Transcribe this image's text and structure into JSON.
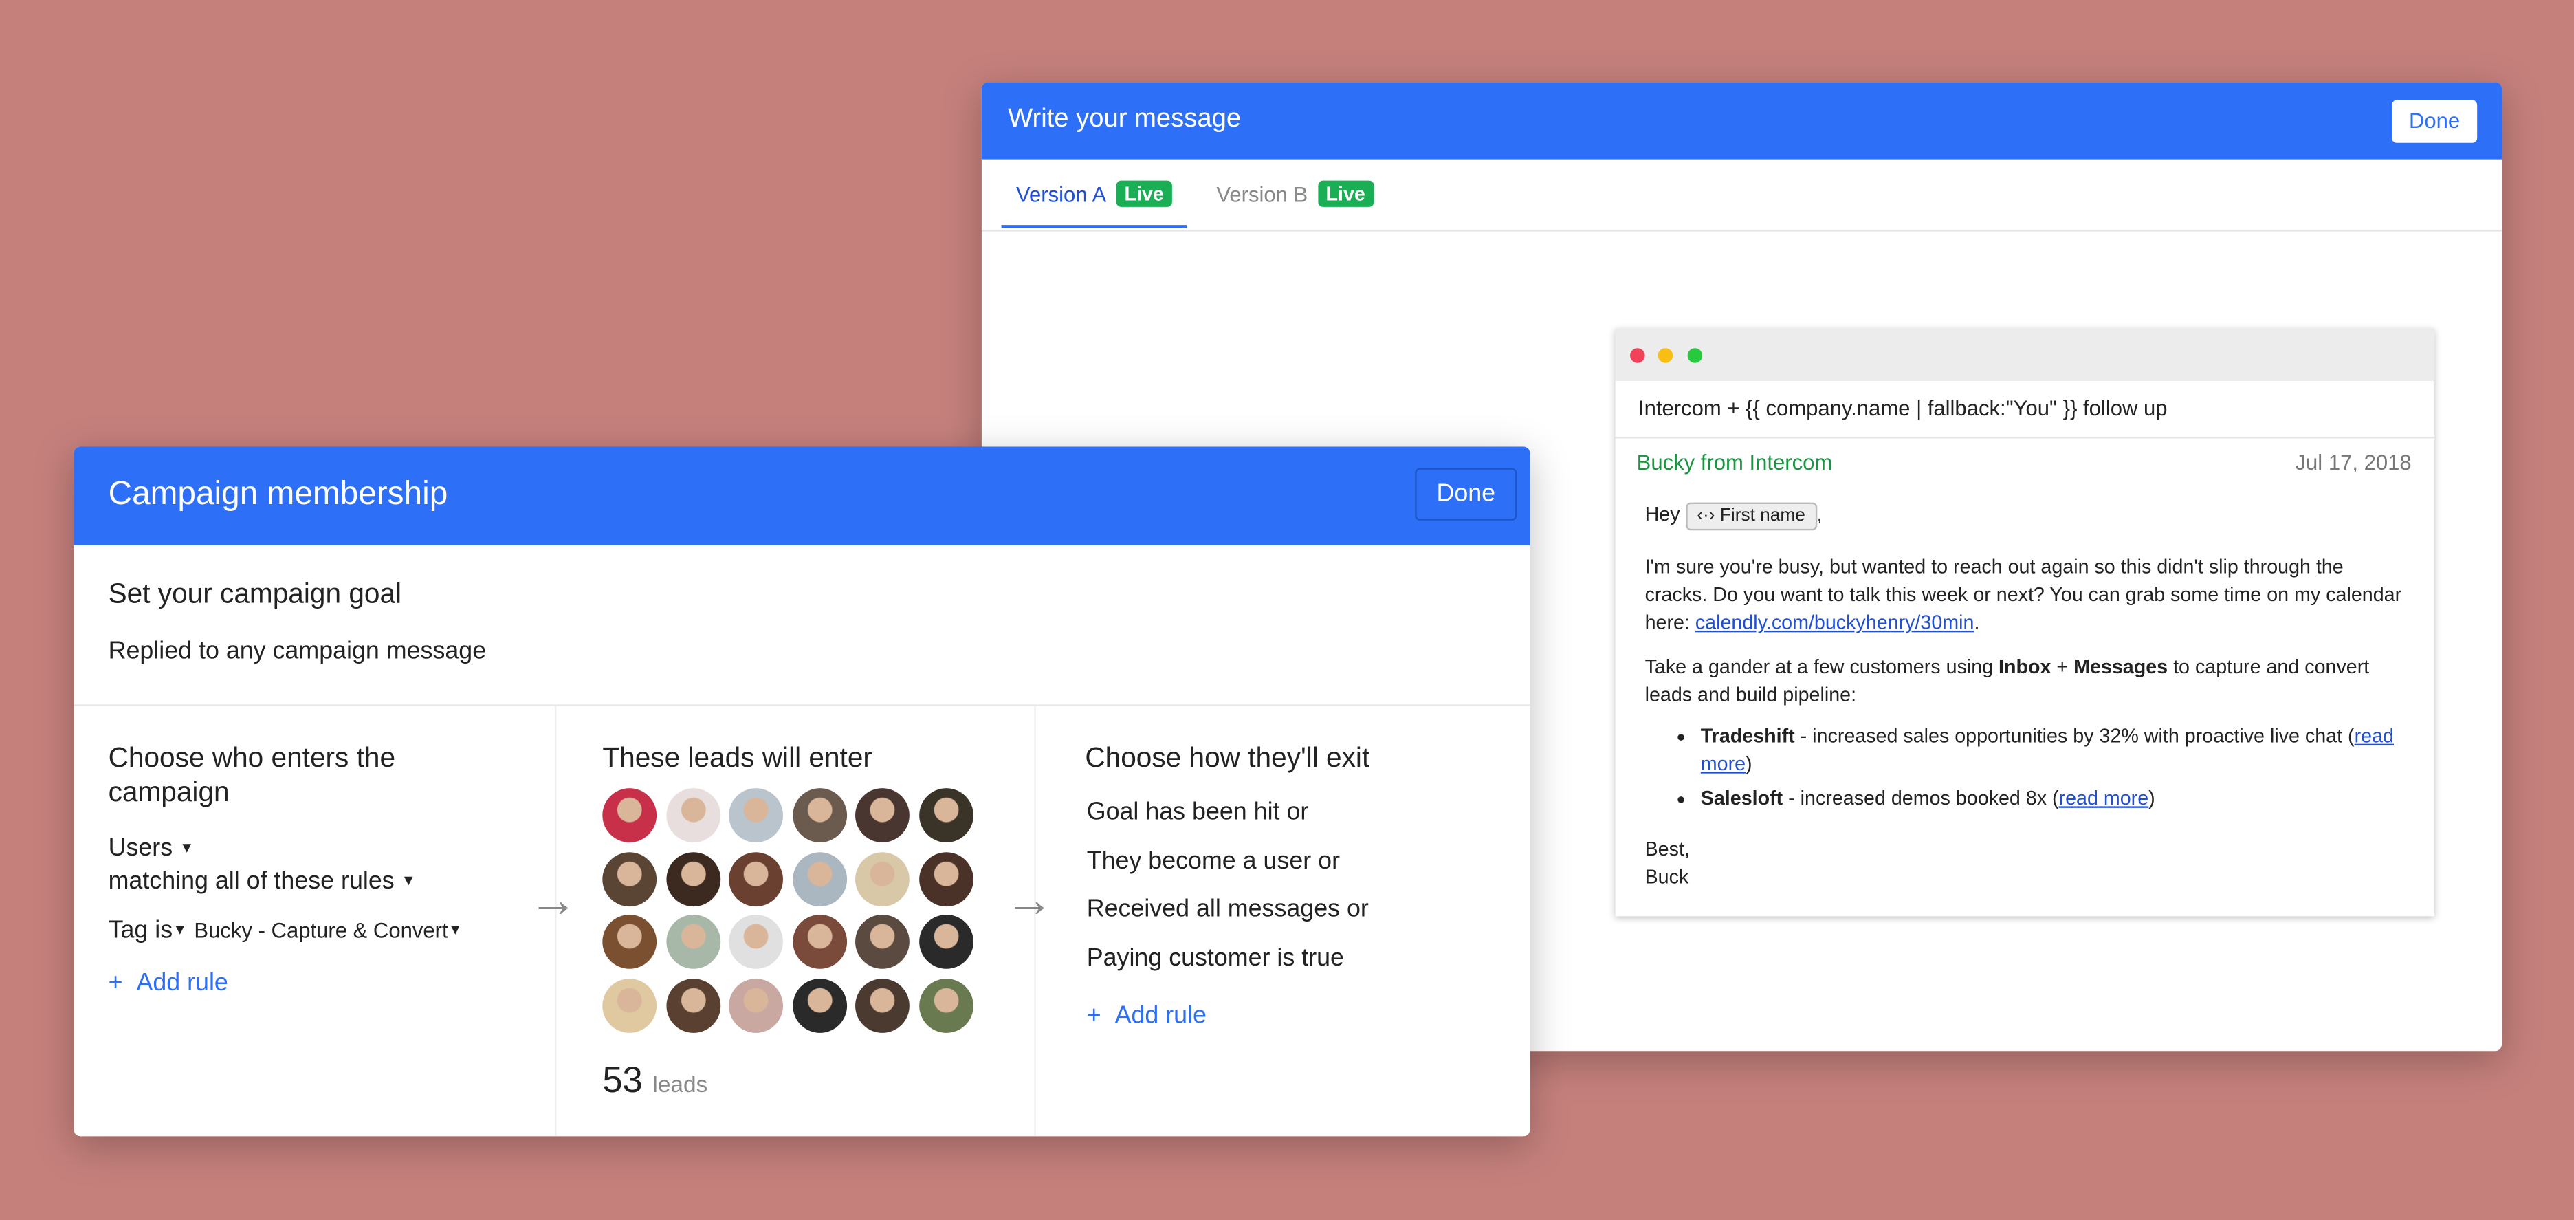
{
  "back_window": {
    "title": "Write your message",
    "done_label": "Done",
    "tabs": [
      {
        "label": "Version A",
        "badge": "Live",
        "active": true
      },
      {
        "label": "Version B",
        "badge": "Live",
        "active": false
      }
    ],
    "email": {
      "subject": "Intercom + {{ company.name | fallback:\"You\" }} follow up",
      "from": "Bucky from Intercom",
      "date": "Jul 17, 2018",
      "greeting": "Hey",
      "chip": "First name",
      "chip_icon": "code-arrows-icon",
      "greeting_end": ",",
      "para1": "I'm sure you're busy, but wanted to reach out again so this didn't slip through the cracks. Do you want to talk this week or next? You can grab some time on my calendar here: ",
      "link": "calendly.com/buckyhenry/30min",
      "para1_end": ".",
      "para2_a": "Take a gander at a few customers using ",
      "para2_b": "Inbox",
      "para2_c": " + ",
      "para2_d": "Messages",
      "para2_e": " to capture and convert leads and build pipeline:",
      "bullets": [
        {
          "bold": "Tradeshift",
          "text": " - increased sales opportunities by 32% with proactive live chat (",
          "link": "read more",
          "end": ")"
        },
        {
          "bold": "Salesloft",
          "text": " - increased demos booked 8x (",
          "link": "read more",
          "end": ")"
        }
      ],
      "signoff": "Best,",
      "name": "Buck"
    },
    "dot_colors": [
      "#f2425a",
      "#f8be14",
      "#27c93f"
    ]
  },
  "front_window": {
    "title": "Campaign membership",
    "done_label": "Done",
    "goal": {
      "heading": "Set your campaign goal",
      "value": "Replied to any campaign message"
    },
    "enter": {
      "heading": "Choose who enters the campaign",
      "audience": "Users",
      "match": "matching all of these rules",
      "rule_attr": "Tag is",
      "rule_value": "Bucky - Capture & Convert",
      "add_rule": "Add rule"
    },
    "leads": {
      "heading": "These leads will enter",
      "count": "53",
      "unit": "leads",
      "avatar_colors": [
        "#c8304a",
        "#e8dede",
        "#b9c4cc",
        "#6b5a4e",
        "#4a3630",
        "#3a3328",
        "#5a4535",
        "#3c2a20",
        "#6a4030",
        "#aab6c0",
        "#d8c8a8",
        "#4a3228",
        "#7a5030",
        "#a8b8a8",
        "#e0e0e0",
        "#7a4a3a",
        "#5a4a40",
        "#2a2a2a",
        "#e0c8a0",
        "#5a4030",
        "#c8a8a0",
        "#2a2a2a",
        "#4a3a30",
        "#6a7a50"
      ]
    },
    "exit": {
      "heading": "Choose how they'll exit",
      "conditions": [
        "Goal has been hit or",
        "They become a user or",
        "Received all messages or",
        "Paying customer is true"
      ],
      "add_rule": "Add rule"
    }
  },
  "colors": {
    "brand_blue": "#2d6ff7",
    "live_green": "#1aaf54",
    "background": "#c5807c"
  }
}
